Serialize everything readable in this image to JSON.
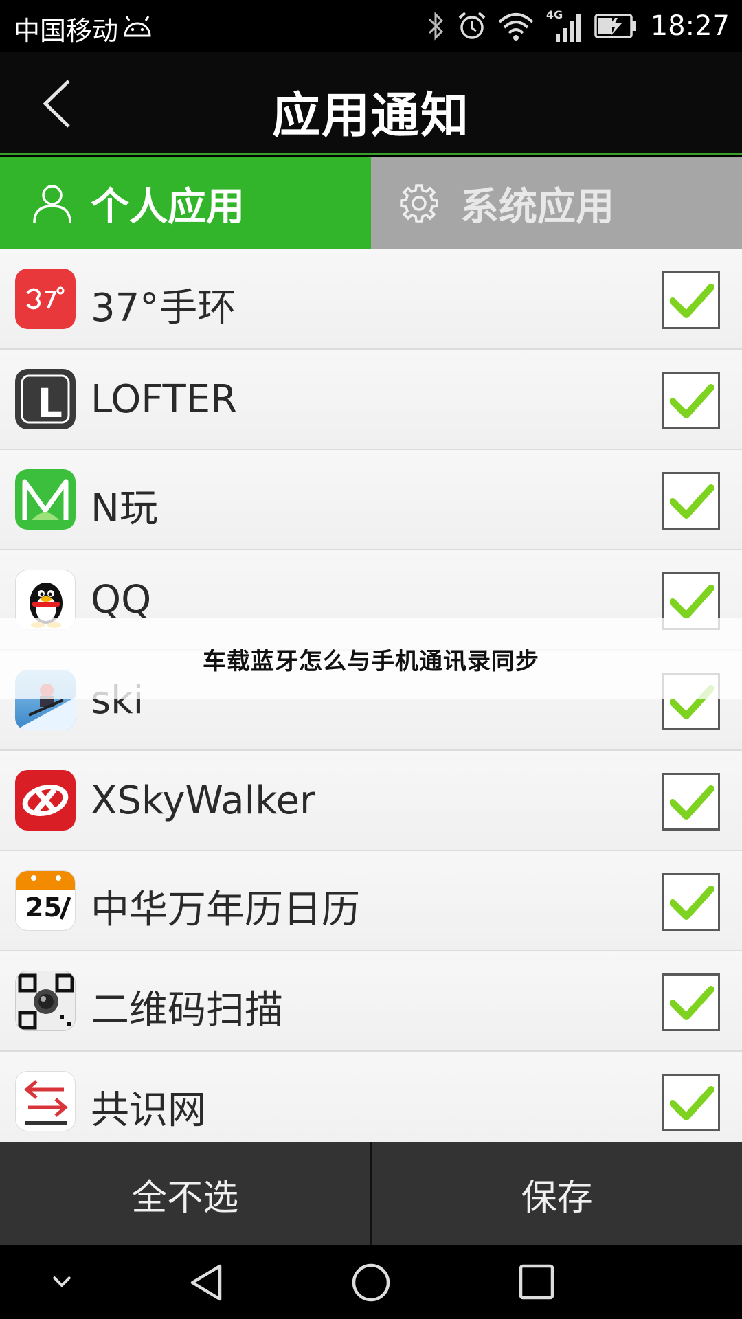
{
  "status_bar": {
    "carrier": "中国移动",
    "network": "4G",
    "time": "18:27"
  },
  "app_bar": {
    "title": "应用通知"
  },
  "tabs": [
    {
      "label": "个人应用",
      "icon": "person-icon",
      "selected": true
    },
    {
      "label": "系统应用",
      "icon": "gear-icon",
      "selected": false
    }
  ],
  "apps": [
    {
      "name": "37°手环",
      "icon": "band-37-icon",
      "checked": true
    },
    {
      "name": "LOFTER",
      "icon": "lofter-icon",
      "checked": true
    },
    {
      "name": "N玩",
      "icon": "nwan-icon",
      "checked": true
    },
    {
      "name": "QQ",
      "icon": "qq-penguin-icon",
      "checked": true
    },
    {
      "name": "ski",
      "icon": "ski-icon",
      "checked": true
    },
    {
      "name": "XSkyWalker",
      "icon": "xskywalker-icon",
      "checked": true
    },
    {
      "name": "中华万年历日历",
      "icon": "calendar-icon",
      "checked": true
    },
    {
      "name": "二维码扫描",
      "icon": "qr-scanner-icon",
      "checked": true
    },
    {
      "name": "共识网",
      "icon": "gongshi-icon",
      "checked": true
    }
  ],
  "calendar_icon": {
    "day": "25"
  },
  "lofter_letter": "L",
  "overlay": {
    "text": "车载蓝牙怎么与手机通讯录同步"
  },
  "actions": {
    "deselect_all": "全不选",
    "save": "保存"
  },
  "colors": {
    "accent": "#33b52b",
    "tab_inactive": "#a6a6a6",
    "check": "#7ed321"
  }
}
